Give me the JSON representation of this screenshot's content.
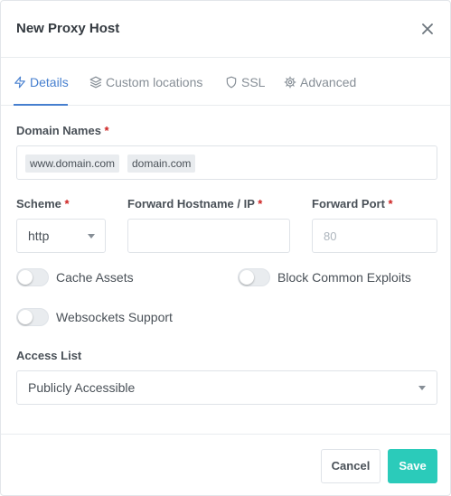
{
  "modal": {
    "title": "New Proxy Host"
  },
  "tabs": [
    {
      "label": "Details",
      "icon": "zap-icon",
      "active": true
    },
    {
      "label": "Custom locations",
      "icon": "layers-icon",
      "active": false
    },
    {
      "label": "SSL",
      "icon": "shield-icon",
      "active": false
    },
    {
      "label": "Advanced",
      "icon": "gear-icon",
      "active": false
    }
  ],
  "form": {
    "domain_names": {
      "label": "Domain Names",
      "required_mark": "*",
      "chips": [
        "www.domain.com",
        "domain.com"
      ]
    },
    "scheme": {
      "label": "Scheme",
      "required_mark": "*",
      "value": "http"
    },
    "forward_host": {
      "label": "Forward Hostname / IP",
      "required_mark": "*",
      "value": ""
    },
    "forward_port": {
      "label": "Forward Port",
      "required_mark": "*",
      "placeholder": "80"
    },
    "toggles": {
      "cache_assets": {
        "label": "Cache Assets",
        "on": false
      },
      "block_exploits": {
        "label": "Block Common Exploits",
        "on": false
      },
      "websockets": {
        "label": "Websockets Support",
        "on": false
      }
    },
    "access_list": {
      "label": "Access List",
      "value": "Publicly Accessible"
    }
  },
  "footer": {
    "cancel_label": "Cancel",
    "save_label": "Save"
  },
  "colors": {
    "accent": "#467fcf",
    "save": "#2bcbba",
    "required": "#cd201f"
  }
}
